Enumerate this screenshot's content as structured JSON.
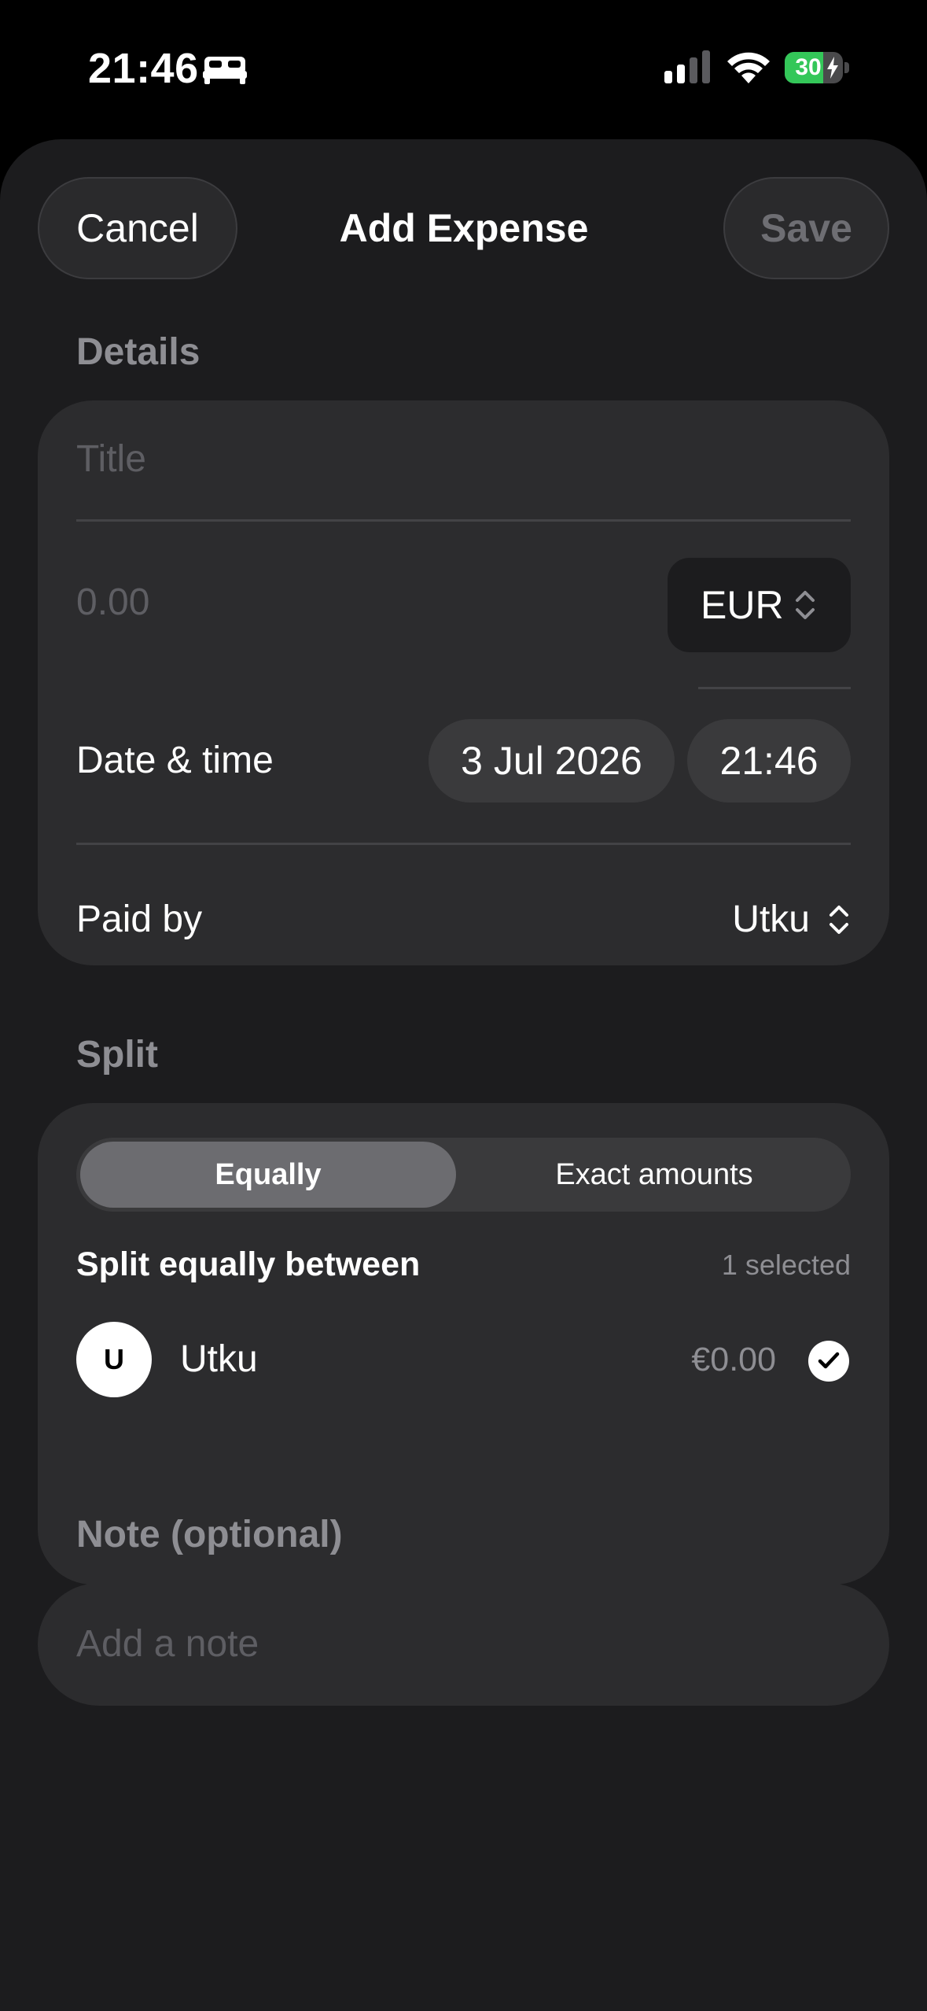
{
  "status_bar": {
    "time": "21:46",
    "focus_icon": "bed-icon",
    "signal_icon": "cellular-signal-icon",
    "wifi_icon": "wifi-icon",
    "battery_level": "30",
    "battery_charging": true,
    "battery_color": "#34c759"
  },
  "header": {
    "cancel_label": "Cancel",
    "title": "Add Expense",
    "save_label": "Save"
  },
  "details": {
    "section_label": "Details",
    "title_placeholder": "Title",
    "amount_placeholder": "0.00",
    "currency": "EUR",
    "date_time_label": "Date & time",
    "date": "3 Jul 2026",
    "time": "21:46",
    "paid_by_label": "Paid by",
    "paid_by_value": "Utku"
  },
  "split": {
    "section_label": "Split",
    "modes": [
      {
        "label": "Equally",
        "active": true
      },
      {
        "label": "Exact amounts",
        "active": false
      }
    ],
    "heading": "Split equally between",
    "selected_count": "1 selected",
    "members": [
      {
        "initial": "U",
        "name": "Utku",
        "amount": "€0.00",
        "selected": true
      }
    ]
  },
  "note": {
    "section_label": "Note (optional)",
    "placeholder": "Add a note"
  }
}
